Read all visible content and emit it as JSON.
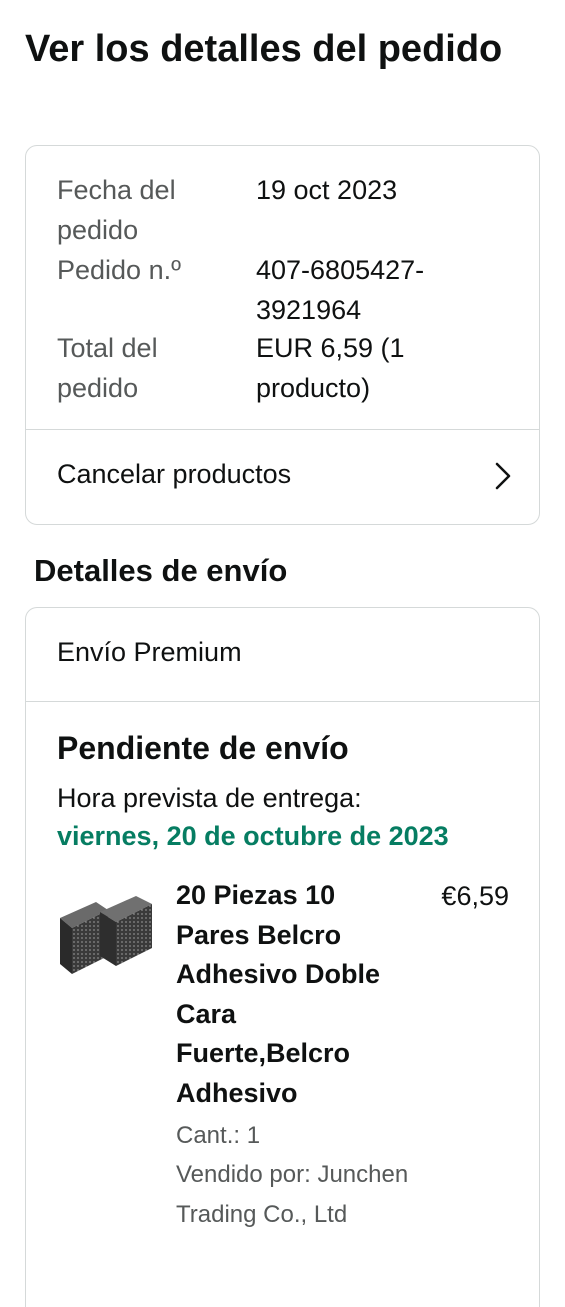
{
  "page": {
    "title": "Ver los detalles del pedido"
  },
  "order_summary": {
    "date_label": "Fecha del pedido",
    "date_value": "19 oct 2023",
    "number_label": "Pedido n.º",
    "number_value": "407-6805427-3921964",
    "total_label": "Total del pedido",
    "total_value": "EUR 6,59 (1 producto)",
    "cancel_label": "Cancelar productos"
  },
  "shipping": {
    "section_title": "Detalles de envío",
    "method": "Envío Premium",
    "status": "Pendiente de envío",
    "eta_label": "Hora prevista de entrega:",
    "eta_date": "viernes, 20 de octubre de 2023",
    "eta_color": "#067d62"
  },
  "product": {
    "title": "20 Piezas 10 Pares Belcro Adhesivo Doble Cara Fuerte,Belcro Adhesivo",
    "price": "€6,59",
    "quantity": "Cant.: 1",
    "seller": "Vendido por: Junchen Trading Co., Ltd"
  }
}
